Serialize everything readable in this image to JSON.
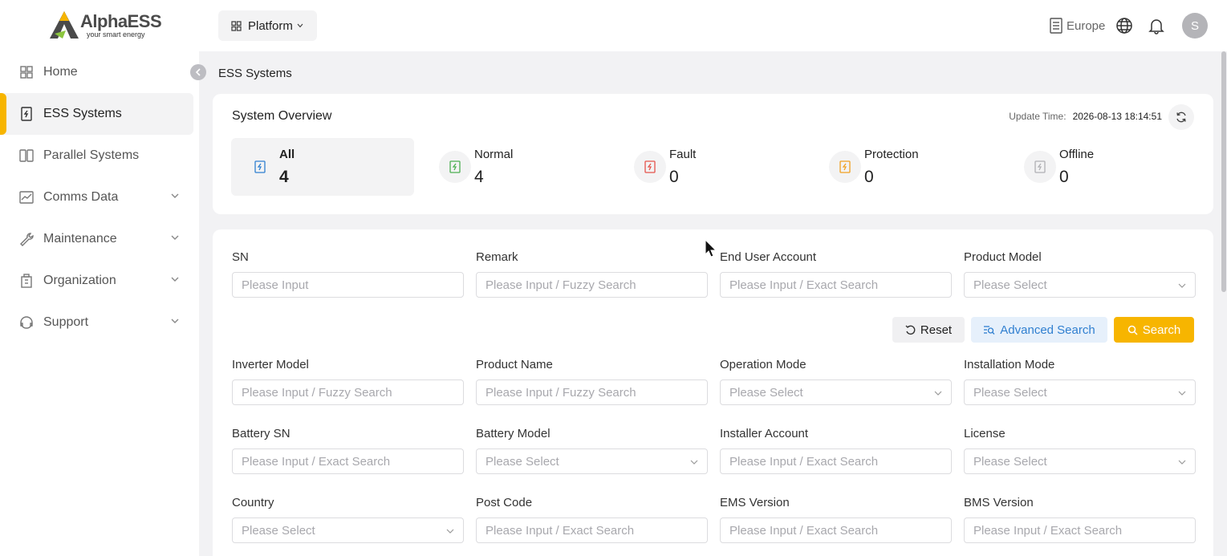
{
  "logo": {
    "brand": "AlphaESS",
    "tagline": "your smart energy"
  },
  "sidebar": {
    "items": [
      {
        "label": "Home",
        "icon": "home-icon",
        "active": false,
        "expandable": false
      },
      {
        "label": "ESS Systems",
        "icon": "ess-icon",
        "active": true,
        "expandable": false
      },
      {
        "label": "Parallel Systems",
        "icon": "parallel-icon",
        "active": false,
        "expandable": false
      },
      {
        "label": "Comms Data",
        "icon": "chart-icon",
        "active": false,
        "expandable": true
      },
      {
        "label": "Maintenance",
        "icon": "wrench-icon",
        "active": false,
        "expandable": true
      },
      {
        "label": "Organization",
        "icon": "building-icon",
        "active": false,
        "expandable": true
      },
      {
        "label": "Support",
        "icon": "support-icon",
        "active": false,
        "expandable": true
      }
    ]
  },
  "topbar": {
    "platform_label": "Platform",
    "region": "Europe",
    "avatar_initial": "S"
  },
  "breadcrumb": "ESS Systems",
  "overview": {
    "title": "System Overview",
    "update_label": "Update Time:",
    "update_value": "2026-08-13 18:14:51",
    "stats": [
      {
        "label": "All",
        "count": "4",
        "color": "#2f7fd0"
      },
      {
        "label": "Normal",
        "count": "4",
        "color": "#4caf50"
      },
      {
        "label": "Fault",
        "count": "0",
        "color": "#e5534b"
      },
      {
        "label": "Protection",
        "count": "0",
        "color": "#f0a020"
      },
      {
        "label": "Offline",
        "count": "0",
        "color": "#b0b0b4"
      }
    ]
  },
  "filters": {
    "row1": [
      {
        "label": "SN",
        "placeholder": "Please Input",
        "select": false
      },
      {
        "label": "Remark",
        "placeholder": "Please Input / Fuzzy Search",
        "select": false
      },
      {
        "label": "End User Account",
        "placeholder": "Please Input / Exact Search",
        "select": false
      },
      {
        "label": "Product Model",
        "placeholder": "Please Select",
        "select": true
      }
    ],
    "row2": [
      {
        "label": "Inverter Model",
        "placeholder": "Please Input / Fuzzy Search",
        "select": false
      },
      {
        "label": "Product Name",
        "placeholder": "Please Input / Fuzzy Search",
        "select": false
      },
      {
        "label": "Operation Mode",
        "placeholder": "Please Select",
        "select": true
      },
      {
        "label": "Installation Mode",
        "placeholder": "Please Select",
        "select": true
      }
    ],
    "row3": [
      {
        "label": "Battery SN",
        "placeholder": "Please Input / Exact Search",
        "select": false
      },
      {
        "label": "Battery Model",
        "placeholder": "Please Select",
        "select": true
      },
      {
        "label": "Installer Account",
        "placeholder": "Please Input / Exact Search",
        "select": false
      },
      {
        "label": "License",
        "placeholder": "Please Select",
        "select": true
      }
    ],
    "row4": [
      {
        "label": "Country",
        "placeholder": "Please Select",
        "select": true
      },
      {
        "label": "Post Code",
        "placeholder": "Please Input / Exact Search",
        "select": false
      },
      {
        "label": "EMS Version",
        "placeholder": "Please Input / Exact Search",
        "select": false
      },
      {
        "label": "BMS Version",
        "placeholder": "Please Input / Exact Search",
        "select": false
      }
    ],
    "buttons": {
      "reset": "Reset",
      "advanced": "Advanced Search",
      "search": "Search"
    }
  },
  "colors": {
    "accent": "#f7b500",
    "link": "#2f7fd0"
  }
}
